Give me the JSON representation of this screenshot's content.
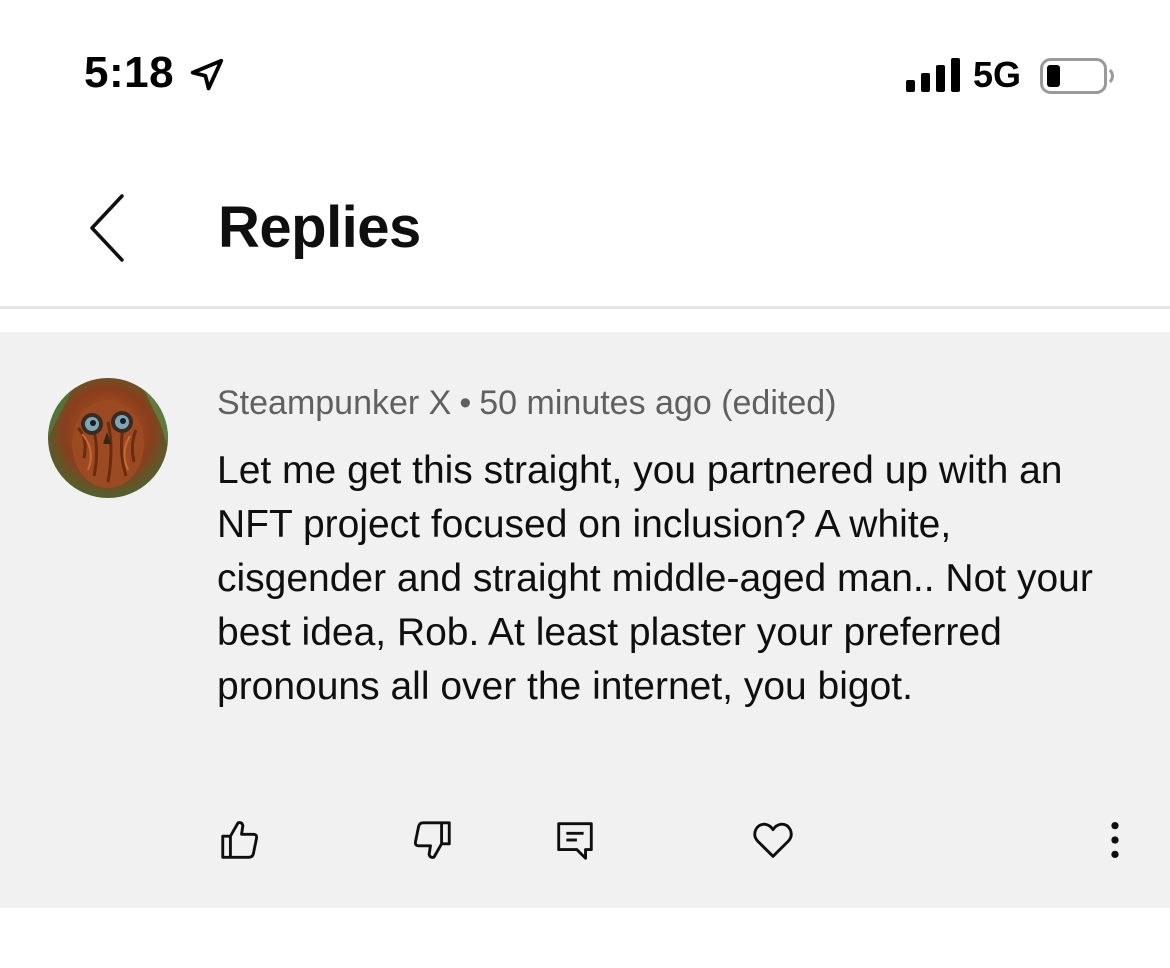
{
  "status_bar": {
    "time": "5:18",
    "network": "5G",
    "icons": [
      "location-arrow-icon",
      "signal-bars-icon",
      "battery-icon"
    ]
  },
  "header": {
    "back_icon": "chevron-left-icon",
    "title": "Replies"
  },
  "comment": {
    "author": "Steampunker X",
    "separator": "•",
    "timestamp": "50 minutes ago (edited)",
    "text": "Let me get this straight, you partnered up with an NFT project focused on inclusion? A white, cisgender and straight middle-aged man.. Not your best idea, Rob. At least plaster your preferred pronouns all over the internet, you bigot.",
    "avatar": "owl-avatar"
  },
  "actions": [
    "thumbs-up-icon",
    "thumbs-down-icon",
    "reply-icon",
    "heart-icon",
    "more-vertical-icon"
  ],
  "colors": {
    "card_background": "#f1f1f1",
    "meta_text": "#606060",
    "primary_text": "#0f0f0f",
    "divider": "#e5e5e5"
  }
}
